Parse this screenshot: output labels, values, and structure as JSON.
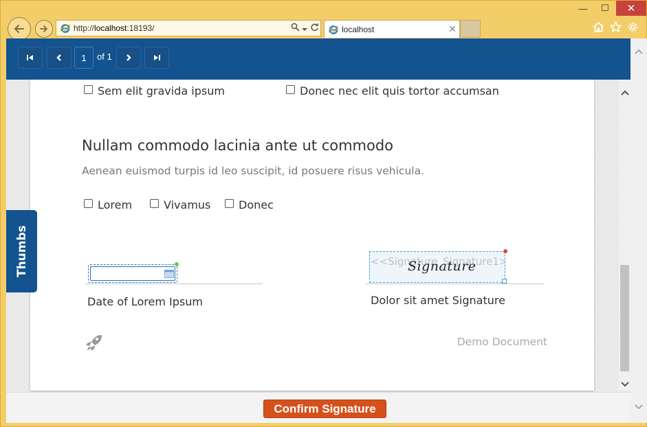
{
  "browser": {
    "url_prefix": "http://",
    "url_host": "localhost",
    "url_rest": ":18193/",
    "tab_title": "localhost",
    "window_controls": [
      "—",
      "☐",
      "✕"
    ],
    "address_icons": [
      "search-icon",
      "dropdown-icon",
      "refresh-icon"
    ],
    "tools": [
      "home-icon",
      "star-icon",
      "gear-icon"
    ]
  },
  "viewer": {
    "page_number": "1",
    "page_of": "of 1",
    "nav_buttons": [
      "first-page",
      "previous-page",
      "next-page",
      "last-page"
    ],
    "thumbs_label": "Thumbs",
    "confirm_label": "Confirm Signature"
  },
  "document": {
    "top_checkboxes": [
      {
        "label": "Sem elit gravida ipsum",
        "checked": false
      },
      {
        "label": "Donec nec elit quis tortor accumsan",
        "checked": false
      }
    ],
    "heading": "Nullam commodo lacinia ante ut commodo",
    "subtext": "Aenean euismod turpis id leo suscipit, id posuere risus vehicula.",
    "option_checkboxes": [
      {
        "label": "Lorem",
        "checked": false
      },
      {
        "label": "Vivamus",
        "checked": false
      },
      {
        "label": "Donec",
        "checked": false
      }
    ],
    "date_field_label": "Date of Lorem Ipsum",
    "date_field_value": "",
    "signature_placeholder": "<<Signature_Signature1>>",
    "signature_script": "Signature",
    "signature_label": "Dolor sit amet Signature",
    "footer_brand": "Demo Document"
  },
  "colors": {
    "toolbar": "#13538f",
    "confirm": "#d4511c",
    "frame": "#f3cd67",
    "required_green": "#6cc04a",
    "required_red": "#e0462a"
  }
}
